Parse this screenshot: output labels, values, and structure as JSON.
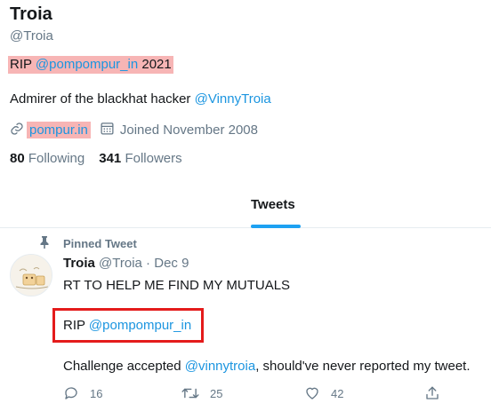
{
  "profile": {
    "name": "Troia",
    "handle": "@Troia",
    "bio_line1_prefix": "RIP ",
    "bio_line1_mention": "@pompompur_in",
    "bio_line1_suffix": " 2021",
    "bio_line2_prefix": "Admirer of the blackhat hacker ",
    "bio_line2_mention": "@VinnyTroia",
    "website": "pompur.in",
    "joined": "Joined November 2008",
    "following_count": "80",
    "following_label": "Following",
    "followers_count": "341",
    "followers_label": "Followers"
  },
  "tabs": {
    "active": "Tweets"
  },
  "tweet": {
    "pinned_label": "Pinned Tweet",
    "author_name": "Troia",
    "author_handle": "@Troia",
    "separator": " · ",
    "date": "Dec 9",
    "line1": "RT TO HELP ME FIND MY MUTUALS",
    "line2_prefix": "RIP ",
    "line2_mention": "@pompompur_in",
    "line3_prefix": "Challenge accepted ",
    "line3_mention": "@vinnytroia",
    "line3_suffix": ", should've never reported my tweet.",
    "replies": "16",
    "retweets": "25",
    "likes": "42"
  },
  "colors": {
    "accent": "#1da1f2",
    "link": "#1b95e0",
    "highlight": "#f7b5b5",
    "annotation_box": "#e41b1b",
    "muted": "#657786"
  },
  "icons": {
    "pin": "pin-icon",
    "link": "link-icon",
    "calendar": "calendar-icon",
    "reply": "reply-icon",
    "retweet": "retweet-icon",
    "like": "heart-icon",
    "share": "share-icon"
  }
}
